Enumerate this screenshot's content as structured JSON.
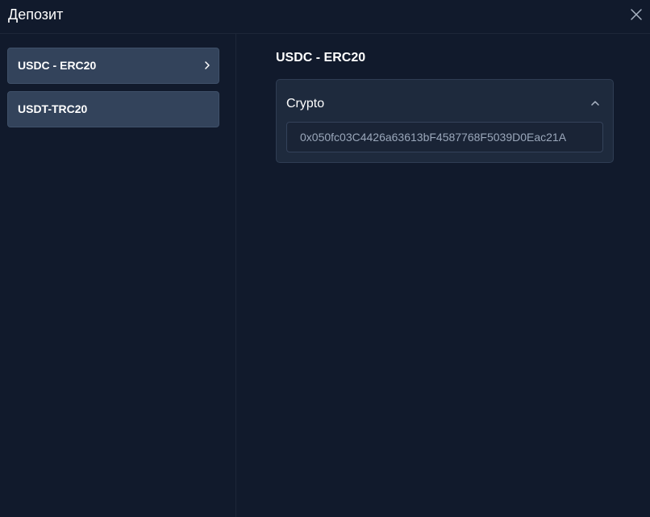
{
  "header": {
    "title": "Депозит",
    "close_icon": "close-icon"
  },
  "sidebar": {
    "items": [
      {
        "label": "USDC - ERC20",
        "selected": true,
        "icon": "chevron-right-icon"
      },
      {
        "label": "USDT-TRC20",
        "selected": false
      }
    ]
  },
  "main": {
    "title": "USDC - ERC20",
    "section": {
      "title": "Crypto",
      "toggle_icon": "chevron-up-icon",
      "expanded": true,
      "address": "0x050fc03C4426a63613bF4587768F5039D0Eac21A"
    }
  },
  "colors": {
    "background": "#111a2c",
    "item_background": "#33435b",
    "card_background": "#1e2a3d",
    "address_text": "#9aa7ba"
  }
}
